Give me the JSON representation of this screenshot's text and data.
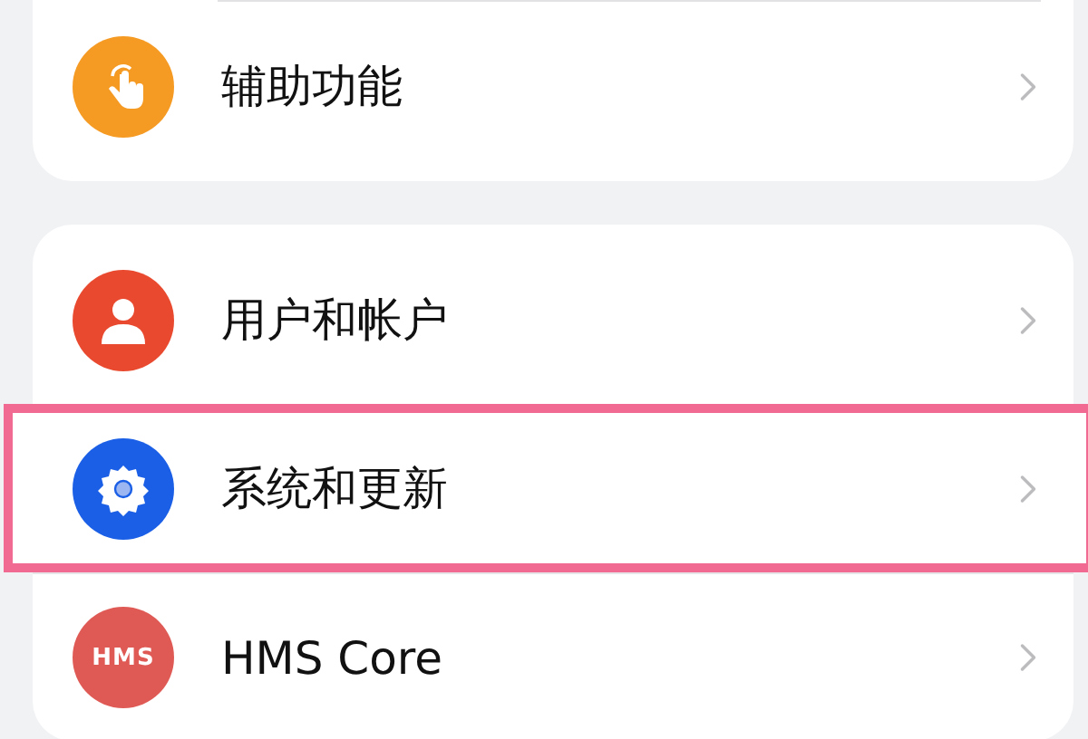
{
  "groups": [
    {
      "items": [
        {
          "kind": "hand",
          "label": "辅助功能",
          "highlighted": false
        }
      ]
    },
    {
      "items": [
        {
          "kind": "person",
          "label": "用户和帐户",
          "highlighted": false
        },
        {
          "kind": "gear",
          "label": "系统和更新",
          "highlighted": true
        },
        {
          "kind": "badge",
          "badge": "HMS",
          "label": "HMS Core",
          "highlighted": false
        }
      ]
    }
  ]
}
